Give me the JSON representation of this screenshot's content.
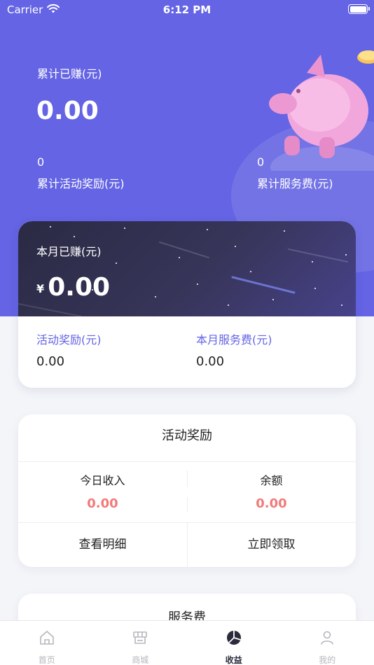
{
  "status_bar": {
    "carrier": "Carrier",
    "time": "6:12 PM"
  },
  "summary": {
    "total_label": "累计已赚(元)",
    "total_value": "0.00",
    "activity_reward_value": "0",
    "activity_reward_label": "累计活动奖励(元)",
    "service_fee_value": "0",
    "service_fee_label": "累计服务费(元)"
  },
  "monthly": {
    "label": "本月已赚(元)",
    "currency_symbol": "¥",
    "value": "0.00",
    "activity_label": "活动奖励(元)",
    "activity_value": "0.00",
    "service_label": "本月服务费(元)",
    "service_value": "0.00"
  },
  "activity_card": {
    "title": "活动奖励",
    "today_label": "今日收入",
    "today_value": "0.00",
    "balance_label": "余额",
    "balance_value": "0.00",
    "detail_button": "查看明细",
    "claim_button": "立即领取"
  },
  "service_card": {
    "title": "服务费"
  },
  "tabbar": {
    "tabs": [
      {
        "label": "首页",
        "icon": "home-icon",
        "active": false
      },
      {
        "label": "商城",
        "icon": "store-icon",
        "active": false
      },
      {
        "label": "收益",
        "icon": "pie-chart-icon",
        "active": true
      },
      {
        "label": "我的",
        "icon": "person-icon",
        "active": false
      }
    ]
  },
  "colors": {
    "header_bg": "#6464e4",
    "accent_text": "#6464e4",
    "value_red": "#f37a7a",
    "month_card_dark": "#2a2a44",
    "tab_active": "#2b2b3c",
    "tab_inactive": "#b6b6be"
  }
}
